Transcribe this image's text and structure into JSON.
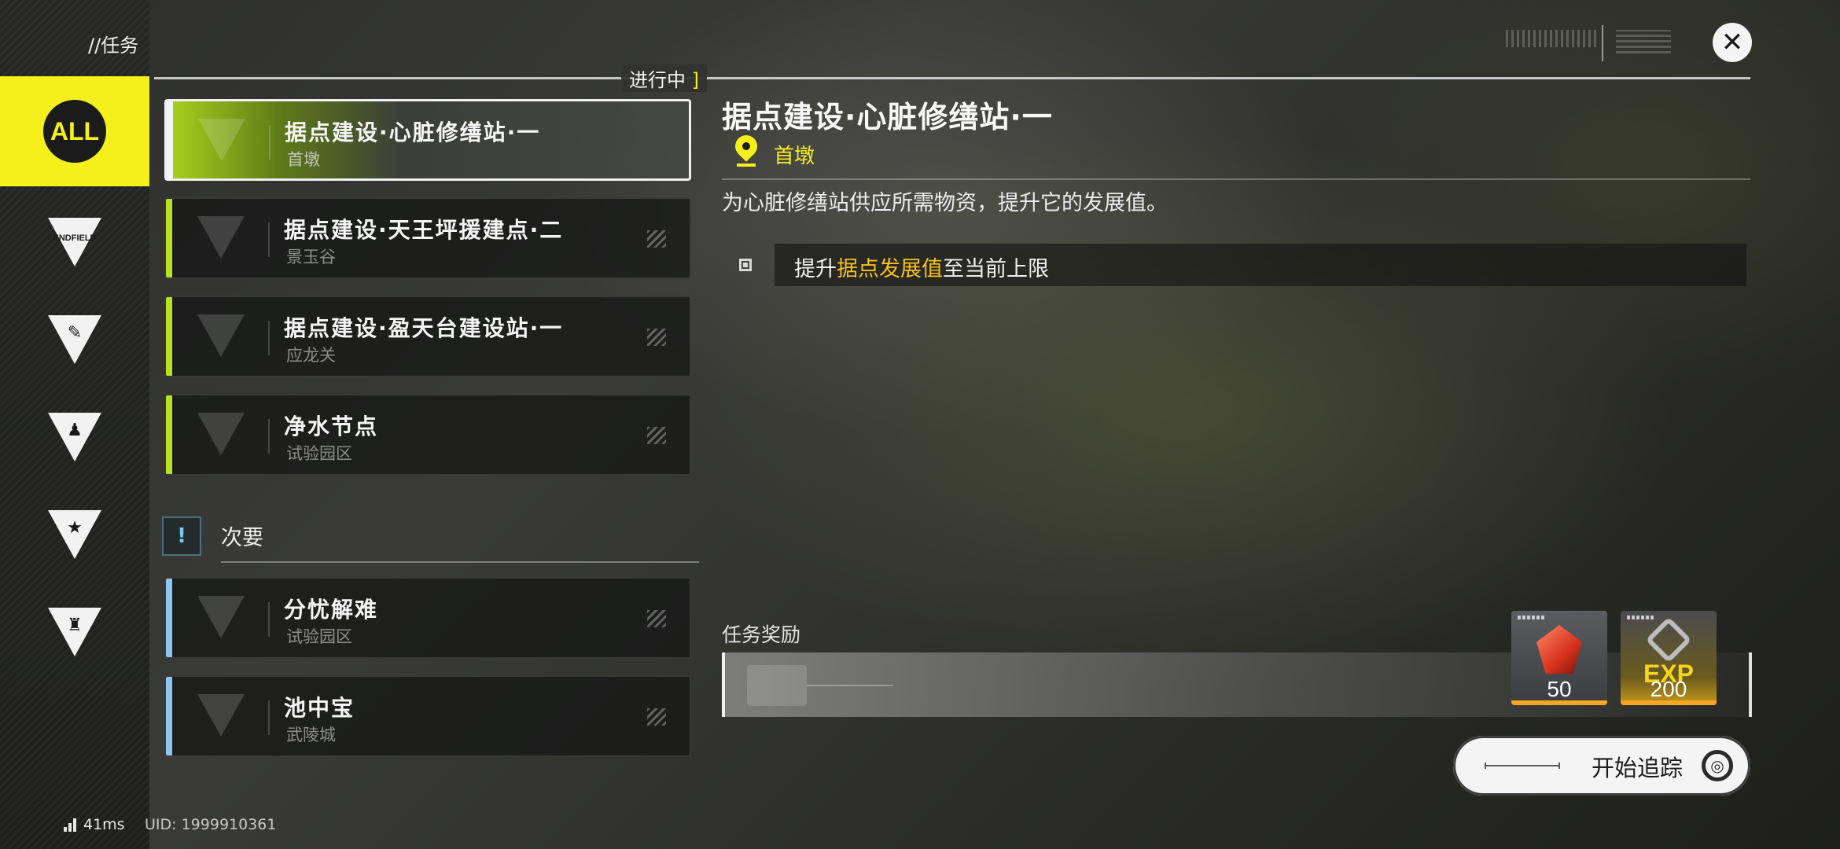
{
  "header": {
    "title": "//任务",
    "close_icon": "close-icon"
  },
  "sidebar": {
    "tabs": [
      {
        "id": "all",
        "label": "ALL",
        "active": true,
        "icon": "all-icon"
      },
      {
        "id": "endfield",
        "label": "ENDFIELD",
        "active": false,
        "icon": "endfield-triangle-icon"
      },
      {
        "id": "faction-2",
        "label": "",
        "active": false,
        "icon": "leaf-triangle-icon"
      },
      {
        "id": "faction-3",
        "label": "",
        "active": false,
        "icon": "person-triangle-icon"
      },
      {
        "id": "faction-4",
        "label": "",
        "active": false,
        "icon": "star-triangle-icon"
      },
      {
        "id": "faction-5",
        "label": "",
        "active": false,
        "icon": "tower-triangle-icon"
      }
    ],
    "accent_color": "#f5ef1c"
  },
  "quest_list": {
    "in_progress_label": "进行中",
    "main_quests": [
      {
        "title": "据点建设·心脏修缮站·一",
        "location": "首墩",
        "selected": true
      },
      {
        "title": "据点建设·天王坪援建点·二",
        "location": "景玉谷",
        "selected": false
      },
      {
        "title": "据点建设·盈天台建设站·一",
        "location": "应龙关",
        "selected": false
      },
      {
        "title": "净水节点",
        "location": "试验园区",
        "selected": false
      }
    ],
    "secondary_label": "次要",
    "secondary_icon": "!",
    "secondary_quests": [
      {
        "title": "分忧解难",
        "location": "试验园区"
      },
      {
        "title": "池中宝",
        "location": "武陵城"
      }
    ],
    "main_accent": "#b6e31d",
    "secondary_accent": "#8ec6ee"
  },
  "detail": {
    "title": "据点建设·心脏修缮站·一",
    "location": "首墩",
    "description": "为心脏修缮站供应所需物资，提升它的发展值。",
    "objective": {
      "prefix": "提升",
      "highlight": "据点发展值",
      "suffix": "至当前上限"
    },
    "rewards_title": "任务奖励",
    "rewards": [
      {
        "name": "crystal-reward",
        "icon": "red-crystal-icon",
        "count": "50"
      },
      {
        "name": "exp-reward",
        "icon": "exp-icon",
        "label": "EXP",
        "count": "200"
      }
    ],
    "track_button_label": "开始追踪",
    "highlight_color": "#f5c21c"
  },
  "footer": {
    "ping": "41ms",
    "uid_label": "UID:",
    "uid_value": "1999910361"
  }
}
